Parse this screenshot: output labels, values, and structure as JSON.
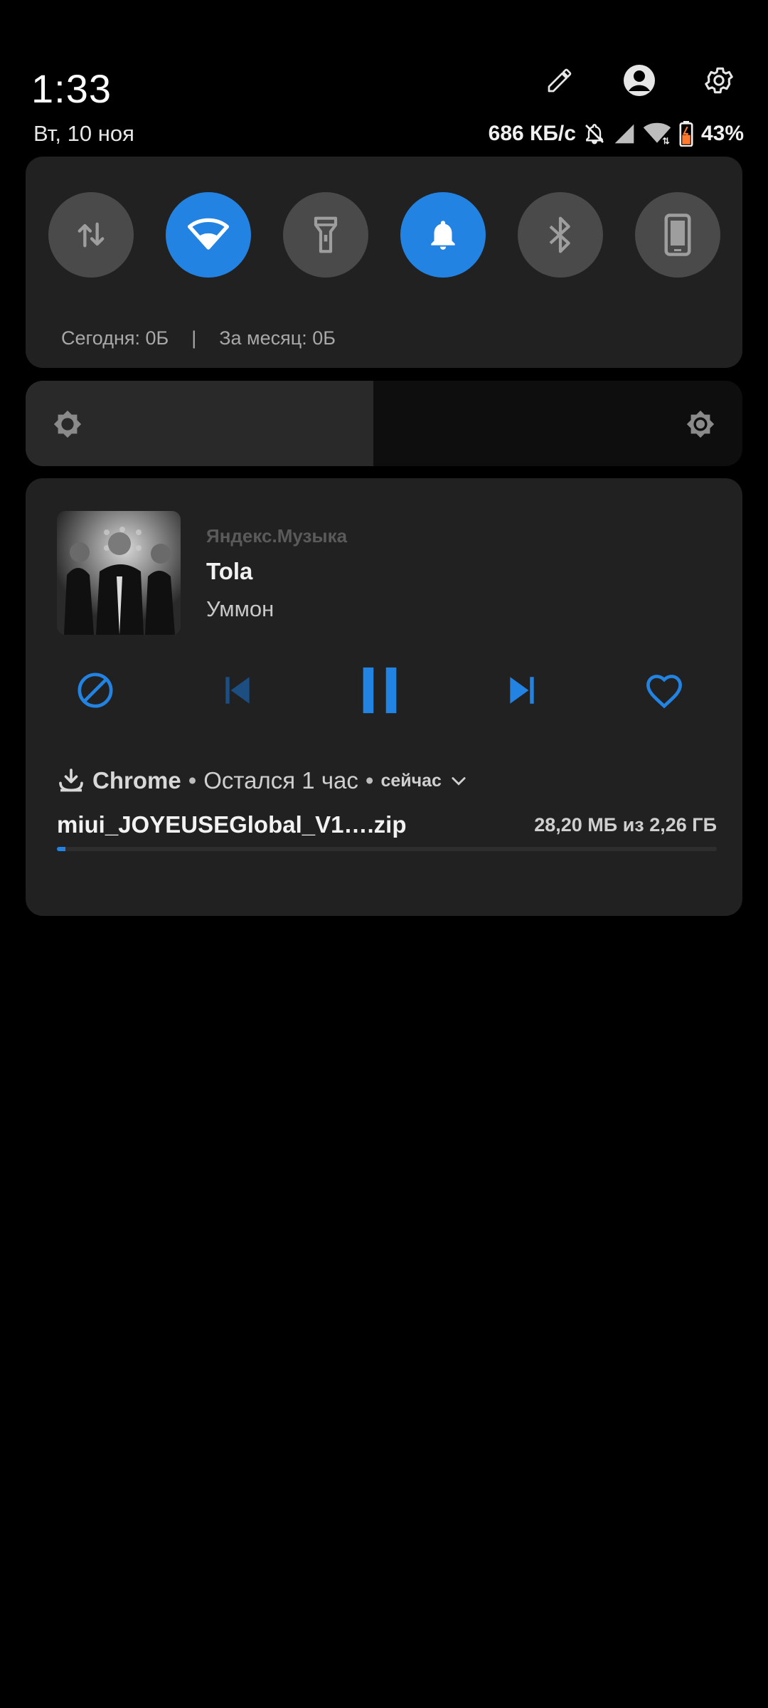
{
  "header": {
    "time": "1:33",
    "date": "Вт, 10 ноя",
    "icons": [
      "edit-icon",
      "account-icon",
      "settings-icon"
    ]
  },
  "status_bar": {
    "net_speed": "686 КБ/с",
    "battery": "43%",
    "icons": [
      "bell-off-icon",
      "cellular-signal-icon",
      "wifi-icon",
      "battery-charging-icon"
    ]
  },
  "quick_settings": {
    "toggles": [
      {
        "name": "mobile-data",
        "icon": "arrows-updown-icon",
        "on": false
      },
      {
        "name": "wifi",
        "icon": "wifi-icon",
        "on": true
      },
      {
        "name": "flashlight",
        "icon": "flashlight-icon",
        "on": false
      },
      {
        "name": "sound",
        "icon": "bell-icon",
        "on": true
      },
      {
        "name": "bluetooth",
        "icon": "bluetooth-icon",
        "on": false
      },
      {
        "name": "rotation",
        "icon": "phone-icon",
        "on": false
      }
    ],
    "data_today": "Сегодня: 0Б",
    "separator": "|",
    "data_month": "За месяц: 0Б"
  },
  "brightness": {
    "level": 0.485
  },
  "media": {
    "app": "Яндекс.Музыка",
    "title": "Tola",
    "artist": "Уммон",
    "controls": [
      "block-icon",
      "previous-icon",
      "pause-icon",
      "next-icon",
      "heart-icon"
    ]
  },
  "download": {
    "app": "Chrome",
    "dot": "•",
    "remaining": "Остался 1 час",
    "time": "сейчас",
    "filename": "miui_JOYEUSEGlobal_V1….zip",
    "size": "28,20 МБ из 2,26 ГБ",
    "progress": 0.0125
  },
  "colors": {
    "accent": "#2383e2",
    "card": "#212121",
    "toggle_off": "#4a4a4a"
  }
}
